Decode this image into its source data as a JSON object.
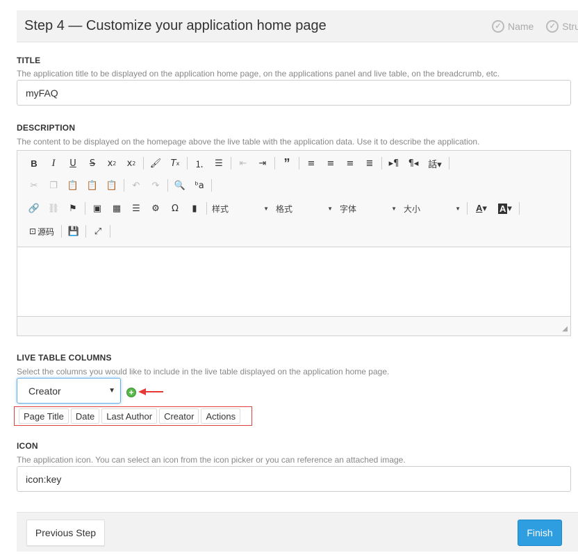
{
  "header": {
    "title": "Step 4 — Customize your application home page",
    "steps": [
      {
        "label": "Name"
      },
      {
        "label": "Stru"
      }
    ]
  },
  "title_section": {
    "label": "TITLE",
    "hint": "The application title to be displayed on the application home page, on the applications panel and live table, on the breadcrumb, etc.",
    "value": "myFAQ"
  },
  "description_section": {
    "label": "DESCRIPTION",
    "hint": "The content to be displayed on the homepage above the live table with the application data. Use it to describe the application.",
    "toolbar": {
      "styles_combo": "样式",
      "format_combo": "格式",
      "font_combo": "字体",
      "size_combo": "大小",
      "source_label": "源码"
    }
  },
  "live_table_section": {
    "label": "LIVE TABLE COLUMNS",
    "hint": "Select the columns you would like to include in the live table displayed on the application home page.",
    "selected_column": "Creator",
    "columns": [
      "Page Title",
      "Date",
      "Last Author",
      "Creator",
      "Actions"
    ]
  },
  "icon_section": {
    "label": "ICON",
    "hint": "The application icon. You can select an icon from the icon picker or you can reference an attached image.",
    "value": "icon:key"
  },
  "footer": {
    "previous_label": "Previous Step",
    "finish_label": "Finish"
  },
  "colors": {
    "accent": "#2e9ee0",
    "highlight_border": "#e04040",
    "add_button": "#59b84b"
  }
}
